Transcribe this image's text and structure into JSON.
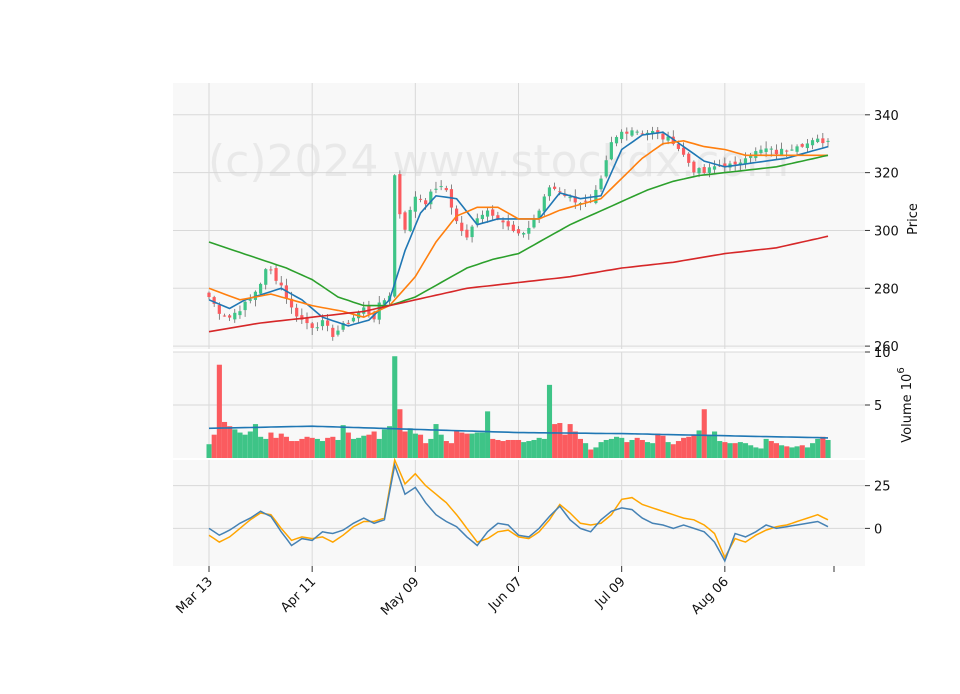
{
  "watermark": "(c)2024 www.stockdx.com",
  "colors": {
    "background": "#f8f8f8",
    "grid": "#d9d9d9",
    "up": "#3ec487",
    "down": "#fb5b5f",
    "ma_short": "#1f77b4",
    "ma_mid": "#ff7f0e",
    "ma_long": "#2ca02c",
    "ma_200": "#d62728",
    "vol_ma": "#1f77b4",
    "osc_fast": "#4682b4",
    "osc_slow": "#ffa500"
  },
  "axes": {
    "price_label": "Price",
    "volume_label": "Volume  10",
    "volume_exponent": "6",
    "price_ticks": [
      "260",
      "280",
      "300",
      "320",
      "340"
    ],
    "volume_ticks": [
      "5",
      "10"
    ],
    "osc_ticks": [
      "0",
      "25"
    ],
    "x_ticks": [
      "Mar 13",
      "Apr 11",
      "May 09",
      "Jun 07",
      "Jul 09",
      "Aug 06"
    ]
  },
  "chart_data": {
    "type": "candlestick",
    "n_points": 121,
    "price_ylim": [
      259,
      351
    ],
    "volume_ylim": [
      0,
      10
    ],
    "osc_ylim": [
      -22,
      40
    ],
    "price_ticks": [
      260,
      280,
      300,
      320,
      340
    ],
    "volume_ticks": [
      5,
      10
    ],
    "osc_ticks": [
      0,
      25
    ],
    "x_ticks": [
      {
        "label": "Mar 13",
        "index": 0
      },
      {
        "label": "Apr 11",
        "index": 20
      },
      {
        "label": "May 09",
        "index": 40
      },
      {
        "label": "Jun 07",
        "index": 60
      },
      {
        "label": "Jul 09",
        "index": 80
      },
      {
        "label": "Aug 06",
        "index": 100
      }
    ],
    "close_anchors": [
      [
        0,
        277
      ],
      [
        2,
        272
      ],
      [
        4,
        270
      ],
      [
        6,
        273
      ],
      [
        8,
        276
      ],
      [
        10,
        282
      ],
      [
        11,
        286
      ],
      [
        12,
        286
      ],
      [
        14,
        281
      ],
      [
        16,
        273
      ],
      [
        18,
        269
      ],
      [
        20,
        267
      ],
      [
        22,
        268
      ],
      [
        24,
        264
      ],
      [
        26,
        267
      ],
      [
        28,
        270
      ],
      [
        30,
        273
      ],
      [
        32,
        270
      ],
      [
        33,
        274
      ],
      [
        35,
        278
      ],
      [
        36,
        319
      ],
      [
        37,
        306
      ],
      [
        38,
        301
      ],
      [
        40,
        312
      ],
      [
        42,
        310
      ],
      [
        44,
        315
      ],
      [
        46,
        314
      ],
      [
        48,
        303
      ],
      [
        50,
        297
      ],
      [
        52,
        305
      ],
      [
        54,
        307
      ],
      [
        56,
        305
      ],
      [
        58,
        301
      ],
      [
        60,
        298
      ],
      [
        62,
        301
      ],
      [
        64,
        307
      ],
      [
        66,
        315
      ],
      [
        68,
        314
      ],
      [
        70,
        311
      ],
      [
        72,
        310
      ],
      [
        74,
        309
      ],
      [
        76,
        317
      ],
      [
        78,
        330
      ],
      [
        80,
        334
      ],
      [
        82,
        335
      ],
      [
        84,
        334
      ],
      [
        86,
        334
      ],
      [
        88,
        332
      ],
      [
        90,
        331
      ],
      [
        92,
        326
      ],
      [
        94,
        321
      ],
      [
        96,
        320
      ],
      [
        98,
        322
      ],
      [
        100,
        323
      ],
      [
        102,
        322
      ],
      [
        104,
        326
      ],
      [
        106,
        327
      ],
      [
        108,
        328
      ],
      [
        110,
        327
      ],
      [
        112,
        328
      ],
      [
        114,
        330
      ],
      [
        116,
        330
      ],
      [
        118,
        331
      ],
      [
        120,
        331
      ]
    ],
    "ma_series": [
      {
        "period": 5,
        "values_anchor": [
          [
            0,
            276
          ],
          [
            4,
            273
          ],
          [
            7,
            276
          ],
          [
            14,
            280
          ],
          [
            18,
            276
          ],
          [
            22,
            270
          ],
          [
            27,
            267
          ],
          [
            31,
            269
          ],
          [
            35,
            276
          ],
          [
            38,
            293
          ],
          [
            41,
            306
          ],
          [
            44,
            312
          ],
          [
            48,
            311
          ],
          [
            52,
            302
          ],
          [
            56,
            304
          ],
          [
            60,
            304
          ],
          [
            64,
            304
          ],
          [
            68,
            313
          ],
          [
            72,
            311
          ],
          [
            76,
            312
          ],
          [
            80,
            328
          ],
          [
            84,
            333
          ],
          [
            88,
            334
          ],
          [
            92,
            329
          ],
          [
            96,
            324
          ],
          [
            100,
            322
          ],
          [
            104,
            323
          ],
          [
            108,
            324
          ],
          [
            112,
            325
          ],
          [
            116,
            327
          ],
          [
            120,
            329
          ]
        ]
      },
      {
        "period": 10,
        "values_anchor": [
          [
            0,
            280
          ],
          [
            6,
            276
          ],
          [
            12,
            278
          ],
          [
            20,
            274
          ],
          [
            26,
            272
          ],
          [
            30,
            270
          ],
          [
            35,
            274
          ],
          [
            40,
            284
          ],
          [
            44,
            296
          ],
          [
            48,
            305
          ],
          [
            52,
            308
          ],
          [
            56,
            308
          ],
          [
            60,
            304
          ],
          [
            64,
            304
          ],
          [
            68,
            307
          ],
          [
            72,
            309
          ],
          [
            76,
            311
          ],
          [
            80,
            318
          ],
          [
            84,
            325
          ],
          [
            88,
            330
          ],
          [
            92,
            331
          ],
          [
            96,
            329
          ],
          [
            100,
            328
          ],
          [
            104,
            326
          ],
          [
            108,
            326
          ],
          [
            112,
            326
          ],
          [
            120,
            326
          ]
        ]
      },
      {
        "period": 20,
        "values_anchor": [
          [
            0,
            296
          ],
          [
            5,
            293
          ],
          [
            10,
            290
          ],
          [
            15,
            287
          ],
          [
            20,
            283
          ],
          [
            25,
            277
          ],
          [
            30,
            274
          ],
          [
            35,
            274
          ],
          [
            40,
            277
          ],
          [
            45,
            282
          ],
          [
            50,
            287
          ],
          [
            55,
            290
          ],
          [
            60,
            292
          ],
          [
            65,
            297
          ],
          [
            70,
            302
          ],
          [
            75,
            306
          ],
          [
            80,
            310
          ],
          [
            85,
            314
          ],
          [
            90,
            317
          ],
          [
            95,
            319
          ],
          [
            100,
            320
          ],
          [
            105,
            321
          ],
          [
            110,
            322
          ],
          [
            115,
            324
          ],
          [
            120,
            326
          ]
        ]
      },
      {
        "period": 200,
        "values_anchor": [
          [
            0,
            265
          ],
          [
            10,
            268
          ],
          [
            20,
            270
          ],
          [
            30,
            272
          ],
          [
            40,
            276
          ],
          [
            50,
            280
          ],
          [
            60,
            282
          ],
          [
            70,
            284
          ],
          [
            80,
            287
          ],
          [
            90,
            289
          ],
          [
            100,
            292
          ],
          [
            110,
            294
          ],
          [
            120,
            298
          ]
        ]
      }
    ],
    "volume_millions": [
      1.3,
      2.2,
      8.8,
      3.4,
      3.0,
      2.7,
      2.4,
      2.2,
      2.5,
      3.2,
      2.0,
      1.8,
      2.4,
      1.9,
      2.3,
      2.0,
      1.6,
      1.6,
      1.8,
      2.0,
      1.9,
      1.8,
      1.6,
      1.9,
      2.0,
      1.7,
      3.1,
      2.4,
      1.8,
      1.9,
      2.1,
      2.2,
      2.5,
      1.8,
      2.7,
      3.0,
      9.6,
      4.6,
      2.5,
      2.8,
      2.3,
      2.2,
      1.4,
      1.8,
      3.2,
      2.2,
      1.6,
      1.4,
      2.6,
      2.4,
      2.3,
      2.3,
      2.4,
      2.4,
      4.4,
      1.8,
      1.7,
      1.6,
      1.7,
      1.7,
      1.7,
      1.5,
      1.6,
      1.7,
      1.9,
      1.8,
      6.9,
      3.2,
      3.3,
      2.2,
      3.2,
      2.5,
      1.8,
      1.4,
      0.8,
      1.0,
      1.5,
      1.7,
      1.8,
      2.0,
      1.9,
      1.5,
      1.7,
      1.9,
      1.7,
      1.5,
      1.4,
      2.3,
      2.1,
      1.5,
      1.3,
      1.6,
      1.9,
      2.0,
      2.2,
      2.6,
      4.6,
      2.2,
      2.5,
      1.6,
      1.5,
      1.4,
      1.4,
      1.5,
      1.4,
      1.2,
      1.0,
      0.9,
      1.8,
      1.6,
      1.4,
      1.2,
      1.1,
      1.0,
      1.1,
      1.2,
      1.0,
      1.4,
      1.8,
      2.0,
      1.7
    ],
    "volume_ma_anchor": [
      [
        0,
        2.8
      ],
      [
        20,
        3.0
      ],
      [
        40,
        2.7
      ],
      [
        60,
        2.4
      ],
      [
        80,
        2.3
      ],
      [
        100,
        2.1
      ],
      [
        120,
        1.9
      ]
    ],
    "osc_fast_anchor": [
      [
        0,
        0
      ],
      [
        2,
        -4
      ],
      [
        4,
        -1
      ],
      [
        6,
        3
      ],
      [
        8,
        6
      ],
      [
        10,
        10
      ],
      [
        12,
        7
      ],
      [
        14,
        -2
      ],
      [
        16,
        -10
      ],
      [
        18,
        -6
      ],
      [
        20,
        -7
      ],
      [
        22,
        -2
      ],
      [
        24,
        -3
      ],
      [
        26,
        -1
      ],
      [
        28,
        3
      ],
      [
        30,
        6
      ],
      [
        32,
        3
      ],
      [
        34,
        5
      ],
      [
        36,
        37
      ],
      [
        38,
        20
      ],
      [
        40,
        24
      ],
      [
        42,
        15
      ],
      [
        44,
        8
      ],
      [
        46,
        4
      ],
      [
        48,
        1
      ],
      [
        50,
        -5
      ],
      [
        52,
        -10
      ],
      [
        54,
        -2
      ],
      [
        56,
        3
      ],
      [
        58,
        2
      ],
      [
        60,
        -4
      ],
      [
        62,
        -5
      ],
      [
        64,
        0
      ],
      [
        66,
        7
      ],
      [
        68,
        13
      ],
      [
        70,
        5
      ],
      [
        72,
        0
      ],
      [
        74,
        -2
      ],
      [
        76,
        5
      ],
      [
        78,
        10
      ],
      [
        80,
        12
      ],
      [
        82,
        11
      ],
      [
        84,
        6
      ],
      [
        86,
        3
      ],
      [
        88,
        2
      ],
      [
        90,
        0
      ],
      [
        92,
        2
      ],
      [
        94,
        0
      ],
      [
        96,
        -2
      ],
      [
        98,
        -8
      ],
      [
        100,
        -19
      ],
      [
        102,
        -3
      ],
      [
        104,
        -5
      ],
      [
        106,
        -2
      ],
      [
        108,
        2
      ],
      [
        110,
        0
      ],
      [
        112,
        1
      ],
      [
        114,
        2
      ],
      [
        116,
        3
      ],
      [
        118,
        4
      ],
      [
        120,
        1
      ]
    ],
    "osc_slow_anchor": [
      [
        0,
        -4
      ],
      [
        2,
        -8
      ],
      [
        4,
        -5
      ],
      [
        6,
        0
      ],
      [
        8,
        5
      ],
      [
        10,
        9
      ],
      [
        12,
        8
      ],
      [
        14,
        0
      ],
      [
        16,
        -7
      ],
      [
        18,
        -5
      ],
      [
        20,
        -6
      ],
      [
        22,
        -5
      ],
      [
        24,
        -8
      ],
      [
        26,
        -4
      ],
      [
        28,
        1
      ],
      [
        30,
        4
      ],
      [
        32,
        4
      ],
      [
        34,
        6
      ],
      [
        36,
        40
      ],
      [
        38,
        26
      ],
      [
        40,
        32
      ],
      [
        42,
        25
      ],
      [
        44,
        20
      ],
      [
        46,
        15
      ],
      [
        48,
        8
      ],
      [
        50,
        0
      ],
      [
        52,
        -8
      ],
      [
        54,
        -6
      ],
      [
        56,
        -2
      ],
      [
        58,
        -1
      ],
      [
        60,
        -5
      ],
      [
        62,
        -6
      ],
      [
        64,
        -2
      ],
      [
        66,
        5
      ],
      [
        68,
        14
      ],
      [
        70,
        9
      ],
      [
        72,
        3
      ],
      [
        74,
        2
      ],
      [
        76,
        3
      ],
      [
        78,
        8
      ],
      [
        80,
        17
      ],
      [
        82,
        18
      ],
      [
        84,
        14
      ],
      [
        86,
        12
      ],
      [
        88,
        10
      ],
      [
        90,
        8
      ],
      [
        92,
        6
      ],
      [
        94,
        5
      ],
      [
        96,
        2
      ],
      [
        98,
        -3
      ],
      [
        100,
        -17
      ],
      [
        102,
        -6
      ],
      [
        104,
        -8
      ],
      [
        106,
        -4
      ],
      [
        108,
        -1
      ],
      [
        110,
        1
      ],
      [
        112,
        2
      ],
      [
        114,
        4
      ],
      [
        116,
        6
      ],
      [
        118,
        8
      ],
      [
        120,
        5
      ]
    ]
  }
}
